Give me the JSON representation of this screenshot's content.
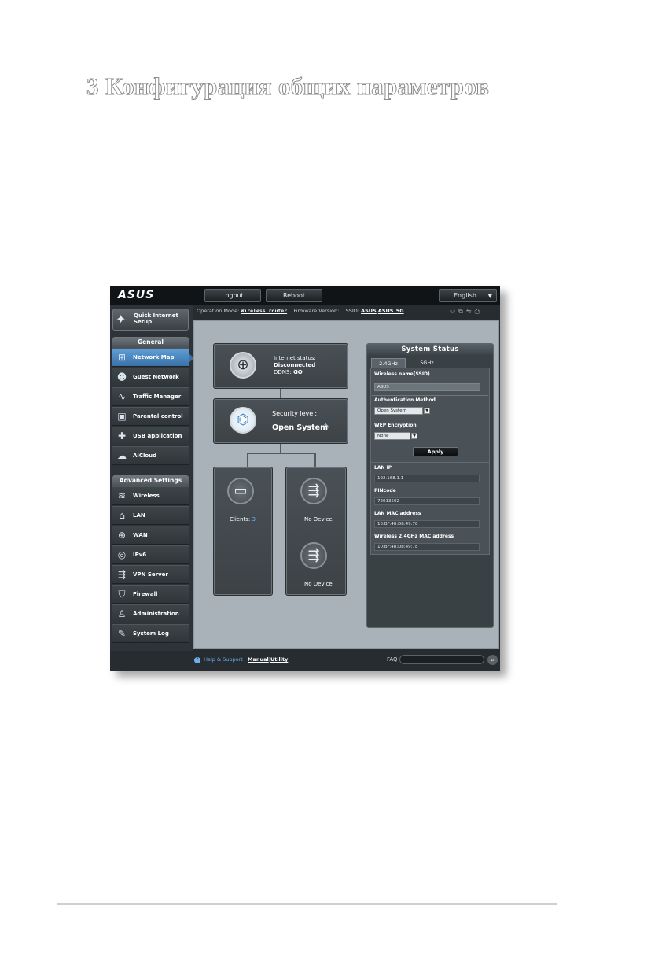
{
  "document": {
    "title": "3 Конфигурация общих параметров"
  },
  "router": {
    "brand": "ASUS",
    "topbar": {
      "logout": "Logout",
      "reboot": "Reboot",
      "language": "English"
    },
    "opbar": {
      "op_mode_label": "Operation Mode:",
      "op_mode_value": "Wireless router",
      "firmware_label": "Firmware Version:",
      "ssid_label": "SSID:",
      "ssid_1": "ASUS",
      "ssid_2": "ASUS_5G"
    },
    "sidebar": {
      "quick_setup": "Quick Internet Setup",
      "general_header": "General",
      "general_items": [
        {
          "label": "Network Map",
          "icon": "network-map-icon"
        },
        {
          "label": "Guest Network",
          "icon": "guest-network-icon"
        },
        {
          "label": "Traffic Manager",
          "icon": "traffic-manager-icon"
        },
        {
          "label": "Parental control",
          "icon": "parental-control-icon"
        },
        {
          "label": "USB application",
          "icon": "usb-application-icon"
        },
        {
          "label": "AiCloud",
          "icon": "aicloud-icon"
        }
      ],
      "advanced_header": "Advanced Settings",
      "advanced_items": [
        {
          "label": "Wireless",
          "icon": "wireless-icon"
        },
        {
          "label": "LAN",
          "icon": "lan-icon"
        },
        {
          "label": "WAN",
          "icon": "wan-icon"
        },
        {
          "label": "IPv6",
          "icon": "ipv6-icon"
        },
        {
          "label": "VPN Server",
          "icon": "vpn-server-icon"
        },
        {
          "label": "Firewall",
          "icon": "firewall-icon"
        },
        {
          "label": "Administration",
          "icon": "administration-icon"
        },
        {
          "label": "System Log",
          "icon": "system-log-icon"
        }
      ]
    },
    "network_map": {
      "internet_status_label": "Internet status:",
      "internet_status_value": "Disconnected",
      "ddns_label": "DDNS:",
      "ddns_link": "GO",
      "security_level_label": "Security level:",
      "security_level_value": "Open System",
      "clients_label": "Clients:",
      "clients_count": "3",
      "usb1_status": "No Device",
      "usb2_status": "No Device"
    },
    "system_status": {
      "title": "System Status",
      "tab_24": "2.4GHz",
      "tab_5": "5GHz",
      "wireless_name_label": "Wireless name(SSID)",
      "wireless_name_value": "ASUS",
      "auth_method_label": "Authentication Method",
      "auth_method_value": "Open System",
      "wep_label": "WEP Encryption",
      "wep_value": "None",
      "apply": "Apply",
      "lan_ip_label": "LAN IP",
      "lan_ip_value": "192.168.1.1",
      "pin_label": "PINcode",
      "pin_value": "72013502",
      "lan_mac_label": "LAN MAC address",
      "lan_mac_value": "10:BF:48:D8:49:78",
      "wl_mac_label": "Wireless 2.4GHz MAC address",
      "wl_mac_value": "10:BF:48:D8:49:78"
    },
    "footer": {
      "help_support": "Help & Support",
      "manual": "Manual",
      "separator": "|",
      "utility": "Utility",
      "faq": "FAQ"
    }
  }
}
